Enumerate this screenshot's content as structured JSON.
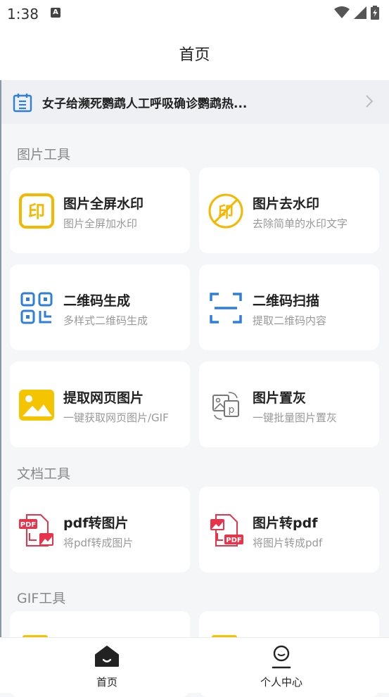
{
  "status_bar": {
    "time": "1:38",
    "notification_badge": "A",
    "icons": [
      "wifi-icon",
      "signal-icon",
      "battery-icon"
    ]
  },
  "header": {
    "title": "首页"
  },
  "notice": {
    "text": "女子给濒死鹦鹉人工呼吸确诊鹦鹉热..."
  },
  "sections": [
    {
      "title": "图片工具",
      "cards": [
        {
          "title": "图片全屏水印",
          "subtitle": "图片全屏加水印",
          "icon": "watermark-icon"
        },
        {
          "title": "图片去水印",
          "subtitle": "去除简单的水印文字",
          "icon": "remove-watermark-icon"
        },
        {
          "title": "二维码生成",
          "subtitle": "多样式二维码生成",
          "icon": "qrcode-icon"
        },
        {
          "title": "二维码扫描",
          "subtitle": "提取二维码内容",
          "icon": "scan-icon"
        },
        {
          "title": "提取网页图片",
          "subtitle": "一键获取网页图片/GIF",
          "icon": "image-icon"
        },
        {
          "title": "图片置灰",
          "subtitle": "一键批量图片置灰",
          "icon": "grayscale-icon"
        }
      ]
    },
    {
      "title": "文档工具",
      "cards": [
        {
          "title": "pdf转图片",
          "subtitle": "将pdf转成图片",
          "icon": "pdf-to-image-icon"
        },
        {
          "title": "图片转pdf",
          "subtitle": "将图片转成pdf",
          "icon": "image-to-pdf-icon"
        }
      ]
    },
    {
      "title": "GIF工具",
      "cards": []
    }
  ],
  "tabbar": {
    "items": [
      {
        "label": "首页",
        "icon": "home-icon",
        "active": true
      },
      {
        "label": "个人中心",
        "icon": "profile-icon",
        "active": false
      }
    ]
  },
  "colors": {
    "accent_yellow": "#f5b800",
    "accent_blue": "#2f7fd8",
    "accent_red": "#e8344a",
    "background": "#f5f6f8"
  }
}
